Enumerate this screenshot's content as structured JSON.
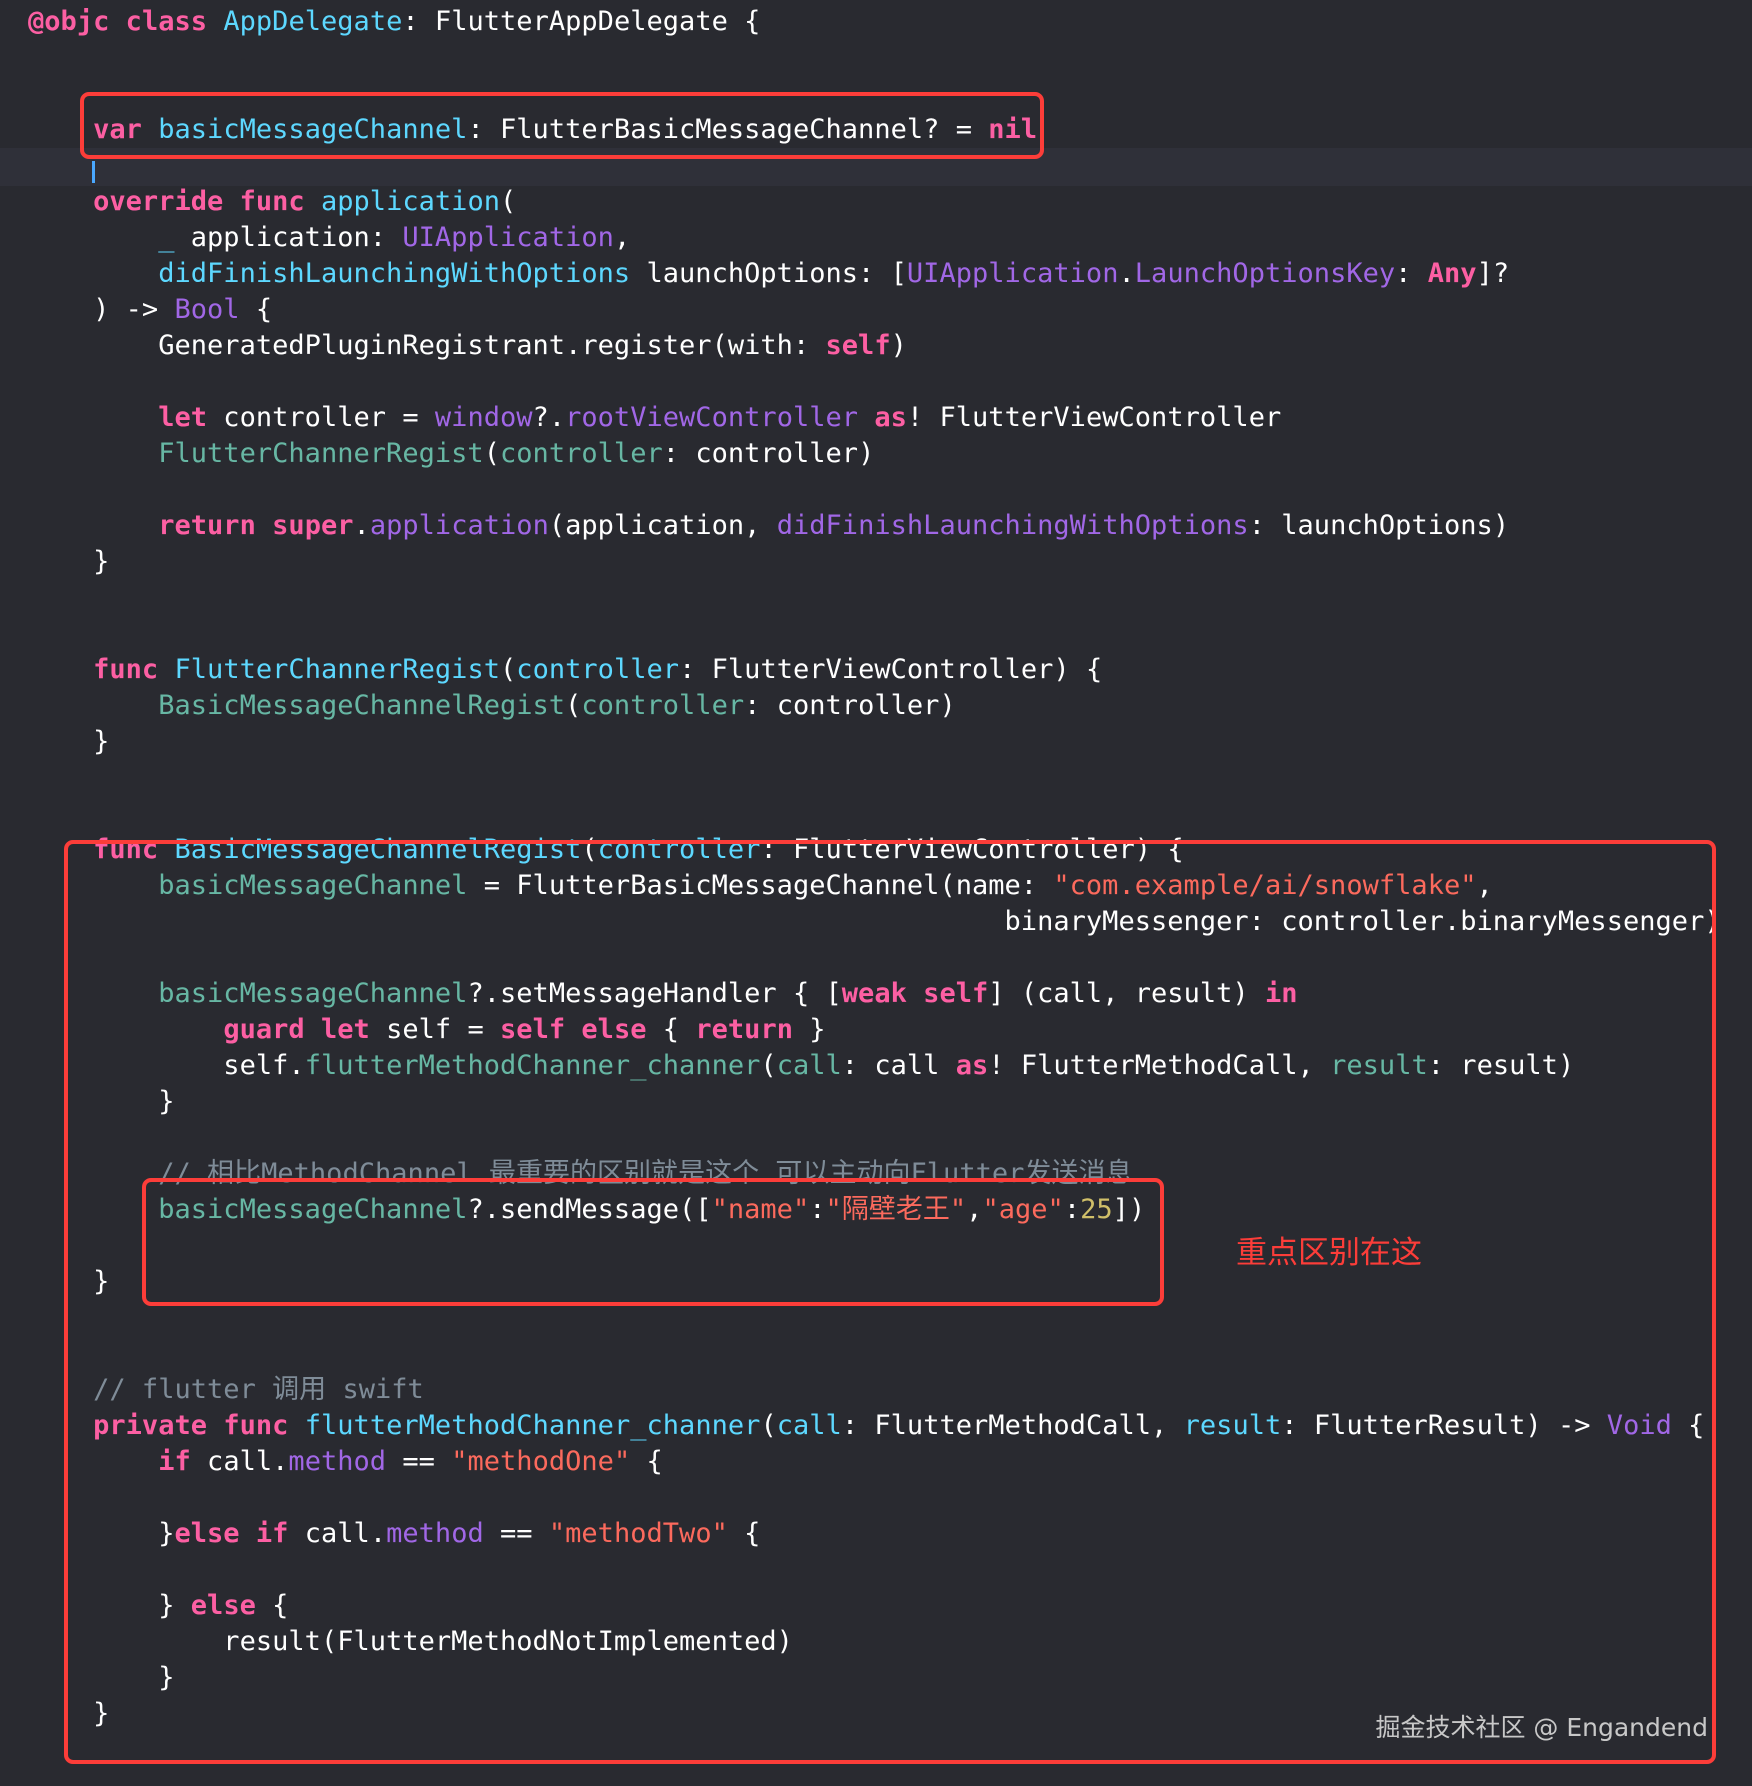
{
  "colors": {
    "background": "#292a30",
    "plain": "#ffffff",
    "keyword": "#fc5fa3",
    "type_decl": "#5dd8ff",
    "project_name": "#67b7a4",
    "other_name": "#a167e6",
    "string": "#fc6a5d",
    "number": "#d0bf69",
    "comment": "#7f8c98",
    "highlight_box": "#fc3d39"
  },
  "lines": [
    [
      [
        "kw",
        "@objc"
      ],
      [
        "p",
        " "
      ],
      [
        "kw",
        "class"
      ],
      [
        "p",
        " "
      ],
      [
        "td",
        "AppDelegate"
      ],
      [
        "p",
        ": FlutterAppDelegate {"
      ]
    ],
    [],
    [],
    [
      [
        "p",
        "    "
      ],
      [
        "kw",
        "var"
      ],
      [
        "p",
        " "
      ],
      [
        "td",
        "basicMessageChannel"
      ],
      [
        "p",
        ": FlutterBasicMessageChannel? = "
      ],
      [
        "kw",
        "nil"
      ]
    ],
    [],
    [
      [
        "p",
        "    "
      ],
      [
        "kw",
        "override"
      ],
      [
        "p",
        " "
      ],
      [
        "kw",
        "func"
      ],
      [
        "p",
        " "
      ],
      [
        "td",
        "application"
      ],
      [
        "p",
        "("
      ]
    ],
    [
      [
        "p",
        "        "
      ],
      [
        "td",
        "_"
      ],
      [
        "p",
        " application: "
      ],
      [
        "on",
        "UIApplication"
      ],
      [
        "p",
        ","
      ]
    ],
    [
      [
        "p",
        "        "
      ],
      [
        "td",
        "didFinishLaunchingWithOptions"
      ],
      [
        "p",
        " launchOptions: ["
      ],
      [
        "on",
        "UIApplication"
      ],
      [
        "p",
        "."
      ],
      [
        "on",
        "LaunchOptionsKey"
      ],
      [
        "p",
        ": "
      ],
      [
        "kw",
        "Any"
      ],
      [
        "p",
        "]?"
      ]
    ],
    [
      [
        "p",
        "    ) -> "
      ],
      [
        "on",
        "Bool"
      ],
      [
        "p",
        " {"
      ]
    ],
    [
      [
        "p",
        "        GeneratedPluginRegistrant.register(with: "
      ],
      [
        "kw",
        "self"
      ],
      [
        "p",
        ")"
      ]
    ],
    [],
    [
      [
        "p",
        "        "
      ],
      [
        "kw",
        "let"
      ],
      [
        "p",
        " controller = "
      ],
      [
        "on",
        "window"
      ],
      [
        "p",
        "?."
      ],
      [
        "on",
        "rootViewController"
      ],
      [
        "p",
        " "
      ],
      [
        "kw",
        "as"
      ],
      [
        "p",
        "! FlutterViewController"
      ]
    ],
    [
      [
        "p",
        "        "
      ],
      [
        "pn",
        "FlutterChannerRegist"
      ],
      [
        "p",
        "("
      ],
      [
        "pn",
        "controller"
      ],
      [
        "p",
        ": controller)"
      ]
    ],
    [],
    [
      [
        "p",
        "        "
      ],
      [
        "kw",
        "return"
      ],
      [
        "p",
        " "
      ],
      [
        "kw",
        "super"
      ],
      [
        "p",
        "."
      ],
      [
        "on",
        "application"
      ],
      [
        "p",
        "(application, "
      ],
      [
        "on",
        "didFinishLaunchingWithOptions"
      ],
      [
        "p",
        ": launchOptions)"
      ]
    ],
    [
      [
        "p",
        "    }"
      ]
    ],
    [],
    [],
    [
      [
        "p",
        "    "
      ],
      [
        "kw",
        "func"
      ],
      [
        "p",
        " "
      ],
      [
        "td",
        "FlutterChannerRegist"
      ],
      [
        "p",
        "("
      ],
      [
        "td",
        "controller"
      ],
      [
        "p",
        ": FlutterViewController) {"
      ]
    ],
    [
      [
        "p",
        "        "
      ],
      [
        "pn",
        "BasicMessageChannelRegist"
      ],
      [
        "p",
        "("
      ],
      [
        "pn",
        "controller"
      ],
      [
        "p",
        ": controller)"
      ]
    ],
    [
      [
        "p",
        "    }"
      ]
    ],
    [],
    [],
    [
      [
        "p",
        "    "
      ],
      [
        "kw",
        "func"
      ],
      [
        "p",
        " "
      ],
      [
        "td",
        "BasicMessageChannelRegist"
      ],
      [
        "p",
        "("
      ],
      [
        "td",
        "controller"
      ],
      [
        "p",
        ": FlutterViewController) {"
      ]
    ],
    [
      [
        "p",
        "        "
      ],
      [
        "pn",
        "basicMessageChannel"
      ],
      [
        "p",
        " = FlutterBasicMessageChannel(name: "
      ],
      [
        "st",
        "\"com.example/ai/snowflake\""
      ],
      [
        "p",
        ","
      ]
    ],
    [
      [
        "p",
        "                                                            binaryMessenger: controller.binaryMessenger)"
      ]
    ],
    [],
    [
      [
        "p",
        "        "
      ],
      [
        "pn",
        "basicMessageChannel"
      ],
      [
        "p",
        "?.setMessageHandler { ["
      ],
      [
        "kw",
        "weak"
      ],
      [
        "p",
        " "
      ],
      [
        "kw",
        "self"
      ],
      [
        "p",
        "] (call, result) "
      ],
      [
        "kw",
        "in"
      ]
    ],
    [
      [
        "p",
        "            "
      ],
      [
        "kw",
        "guard"
      ],
      [
        "p",
        " "
      ],
      [
        "kw",
        "let"
      ],
      [
        "p",
        " self = "
      ],
      [
        "kw",
        "self"
      ],
      [
        "p",
        " "
      ],
      [
        "kw",
        "else"
      ],
      [
        "p",
        " { "
      ],
      [
        "kw",
        "return"
      ],
      [
        "p",
        " }"
      ]
    ],
    [
      [
        "p",
        "            self."
      ],
      [
        "pn",
        "flutterMethodChanner_channer"
      ],
      [
        "p",
        "("
      ],
      [
        "pn",
        "call"
      ],
      [
        "p",
        ": call "
      ],
      [
        "kw",
        "as"
      ],
      [
        "p",
        "! FlutterMethodCall, "
      ],
      [
        "pn",
        "result"
      ],
      [
        "p",
        ": result)"
      ]
    ],
    [
      [
        "p",
        "        }"
      ]
    ],
    [],
    [
      [
        "cm",
        "        // 相比MethodChannel 最重要的区别就是这个 可以主动向Flutter发送消息"
      ]
    ],
    [
      [
        "p",
        "        "
      ],
      [
        "pn",
        "basicMessageChannel"
      ],
      [
        "p",
        "?.sendMessage(["
      ],
      [
        "st",
        "\"name\""
      ],
      [
        "p",
        ":"
      ],
      [
        "st",
        "\"隔壁老王\""
      ],
      [
        "p",
        ","
      ],
      [
        "st",
        "\"age\""
      ],
      [
        "p",
        ":"
      ],
      [
        "nu",
        "25"
      ],
      [
        "p",
        "])"
      ]
    ],
    [],
    [
      [
        "p",
        "    }"
      ]
    ],
    [],
    [],
    [
      [
        "cm",
        "    // flutter 调用 swift"
      ]
    ],
    [
      [
        "p",
        "    "
      ],
      [
        "kw",
        "private"
      ],
      [
        "p",
        " "
      ],
      [
        "kw",
        "func"
      ],
      [
        "p",
        " "
      ],
      [
        "td",
        "flutterMethodChanner_channer"
      ],
      [
        "p",
        "("
      ],
      [
        "td",
        "call"
      ],
      [
        "p",
        ": FlutterMethodCall, "
      ],
      [
        "td",
        "result"
      ],
      [
        "p",
        ": FlutterResult) -> "
      ],
      [
        "on",
        "Void"
      ],
      [
        "p",
        " {"
      ]
    ],
    [
      [
        "p",
        "        "
      ],
      [
        "kw",
        "if"
      ],
      [
        "p",
        " call."
      ],
      [
        "on",
        "method"
      ],
      [
        "p",
        " == "
      ],
      [
        "st",
        "\"methodOne\""
      ],
      [
        "p",
        " {"
      ]
    ],
    [],
    [
      [
        "p",
        "        }"
      ],
      [
        "kw",
        "else"
      ],
      [
        "p",
        " "
      ],
      [
        "kw",
        "if"
      ],
      [
        "p",
        " call."
      ],
      [
        "on",
        "method"
      ],
      [
        "p",
        " == "
      ],
      [
        "st",
        "\"methodTwo\""
      ],
      [
        "p",
        " {"
      ]
    ],
    [],
    [
      [
        "p",
        "        } "
      ],
      [
        "kw",
        "else"
      ],
      [
        "p",
        " {"
      ]
    ],
    [
      [
        "p",
        "            result(FlutterMethodNotImplemented)"
      ]
    ],
    [
      [
        "p",
        "        }"
      ]
    ],
    [
      [
        "p",
        "    }"
      ]
    ]
  ],
  "annotation": "重点区别在这",
  "watermark": "掘金技术社区 @ Engandend"
}
